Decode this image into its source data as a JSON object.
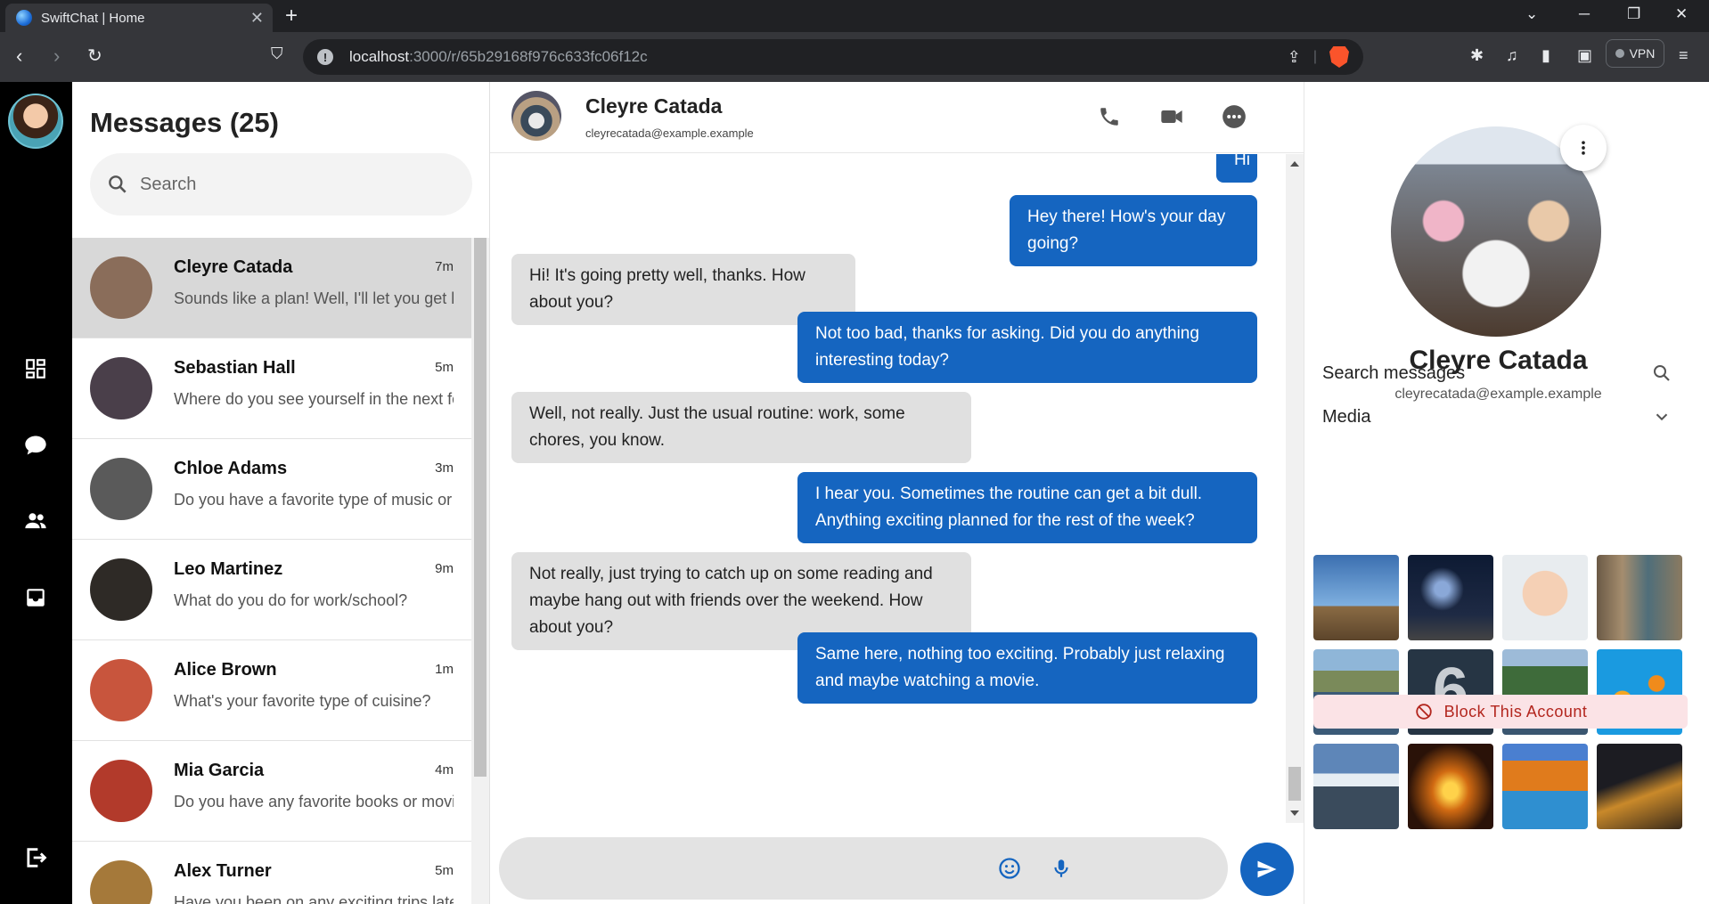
{
  "browser": {
    "tab_title": "SwiftChat | Home",
    "tab_close": "✕",
    "new_tab": "+",
    "url_host": "localhost",
    "url_path": ":3000/r/65b29168f976c633fc06f12c",
    "vpn_label": "VPN"
  },
  "messages_panel": {
    "title": "Messages (25)",
    "search_placeholder": "Search",
    "conversations": [
      {
        "name": "Cleyre Catada",
        "time": "7m",
        "preview": "Sounds like a plan! Well, I'll let you get back to it",
        "avatar_color": "#8a6d5a",
        "active": true
      },
      {
        "name": "Sebastian Hall",
        "time": "5m",
        "preview": "Where do you see yourself in the next few years?",
        "avatar_color": "#4a3f4a"
      },
      {
        "name": "Chloe Adams",
        "time": "3m",
        "preview": "Do you have a favorite type of music or artist?",
        "avatar_color": "#5a5a5a"
      },
      {
        "name": "Leo Martinez",
        "time": "9m",
        "preview": "What do you do for work/school?",
        "avatar_color": "#2e2a26"
      },
      {
        "name": "Alice Brown",
        "time": "1m",
        "preview": "What's your favorite type of cuisine?",
        "avatar_color": "#c8553d"
      },
      {
        "name": "Mia Garcia",
        "time": "4m",
        "preview": "Do you have any favorite books or movies?",
        "avatar_color": "#b23a2b"
      },
      {
        "name": "Alex Turner",
        "time": "5m",
        "preview": "Have you been on any exciting trips lately?",
        "avatar_color": "#a5793a"
      }
    ]
  },
  "chat": {
    "contact_name": "Cleyre Catada",
    "contact_email": "cleyrecatada@example.example",
    "messages": [
      {
        "dir": "out",
        "text": "Hi"
      },
      {
        "dir": "out",
        "text": "Hey there! How's your day going?"
      },
      {
        "dir": "in",
        "text": "Hi! It's going pretty well, thanks. How about you?"
      },
      {
        "dir": "out",
        "text": "Not too bad, thanks for asking. Did you do anything interesting today?"
      },
      {
        "dir": "in",
        "text": "Well, not really. Just the usual routine: work, some chores, you know."
      },
      {
        "dir": "out",
        "text": "I hear you. Sometimes the routine can get a bit dull. Anything exciting planned for the rest of the week?"
      },
      {
        "dir": "in",
        "text": "Not really, just trying to catch up on some reading and maybe hang out with friends over the weekend. How about you?"
      },
      {
        "dir": "out",
        "text": "Same here, nothing too exciting. Probably just relaxing and maybe watching a movie."
      }
    ],
    "composer_value": ""
  },
  "profile": {
    "name": "Cleyre Catada",
    "email": "cleyrecatada@example.example",
    "search_messages_label": "Search messages",
    "media_label": "Media",
    "block_label": "Block This Account"
  },
  "colors": {
    "accent": "#1565c0",
    "incoming_bubble": "#e0e0e0",
    "block_bg": "#fbe3e6",
    "block_text": "#b3261e"
  }
}
